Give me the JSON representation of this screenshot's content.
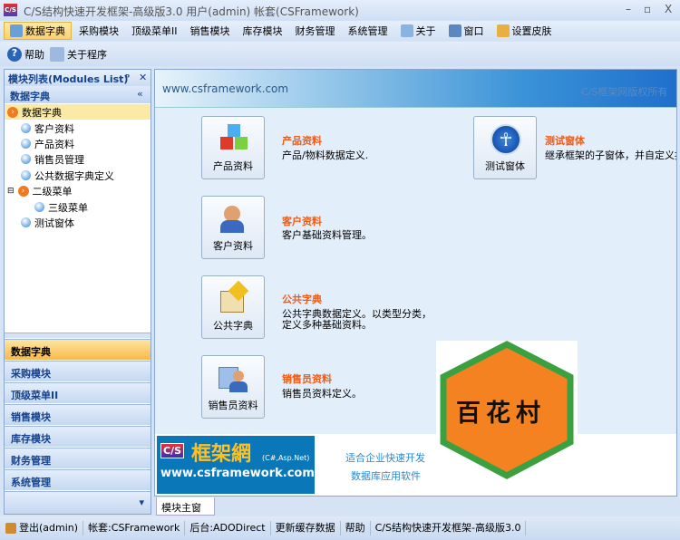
{
  "window": {
    "title": "C/S结构快速开发框架-高级版3.0 用户(admin) 帐套(CSFramework)",
    "logo": "C/S",
    "min": "–",
    "max": "▫",
    "close": "X"
  },
  "menu": [
    "数据字典",
    "采购模块",
    "顶级菜单II",
    "销售模块",
    "库存模块",
    "财务管理",
    "系统管理",
    "关于",
    "窗口",
    "设置皮肤"
  ],
  "toolbar": {
    "help": "帮助",
    "about": "关于程序"
  },
  "left": {
    "title": "模块列表(Modules List)",
    "pin": "ᵖ",
    "close": "✕",
    "section": "数据字典",
    "collapse": "«",
    "tree": [
      "数据字典",
      "客户资料",
      "产品资料",
      "销售员管理",
      "公共数据字典定义",
      "二级菜单",
      "三级菜单",
      "测试窗体"
    ],
    "groups": [
      "数据字典",
      "采购模块",
      "顶级菜单II",
      "销售模块",
      "库存模块",
      "财务管理",
      "系统管理"
    ],
    "more": "▾"
  },
  "content": {
    "site": "www.csframework.com",
    "copyright": "C/S框架网版权所有",
    "items": [
      {
        "button": "产品资料",
        "title": "产品资料",
        "desc": "产品/物料数据定义."
      },
      {
        "button": "客户资料",
        "title": "客户资料",
        "desc": "客户基础资料管理。"
      },
      {
        "button": "公共字典",
        "title": "公共字典",
        "desc": "公共字典数据定义。以类型分类，\n定义多种基础资料。"
      },
      {
        "button": "销售员资料",
        "title": "销售员资料",
        "desc": "销售员资料定义。"
      },
      {
        "button": "测试窗体",
        "title": "测试窗体",
        "desc": "继承框架的子窗体，并自定义按钮"
      }
    ],
    "logo": {
      "cs": "C/S",
      "name": "框架網",
      "tech": "(C#,Asp.Net)",
      "url": "www.csframework.com"
    },
    "slogan1": "适合企业快速开发",
    "slogan2": "数据库应用软件",
    "watermark": "百花村"
  },
  "tab": "模块主窗体",
  "status": [
    "登出(admin)",
    "帐套:CSFramework",
    "后台:ADODirect",
    "更新缓存数据",
    "帮助",
    "C/S结构快速开发框架-高级版3.0"
  ]
}
